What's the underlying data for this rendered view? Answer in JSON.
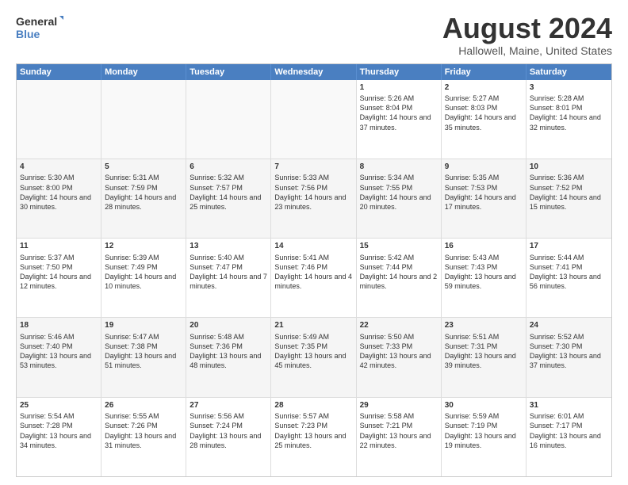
{
  "logo": {
    "line1": "General",
    "line2": "Blue"
  },
  "title": "August 2024",
  "location": "Hallowell, Maine, United States",
  "headers": [
    "Sunday",
    "Monday",
    "Tuesday",
    "Wednesday",
    "Thursday",
    "Friday",
    "Saturday"
  ],
  "rows": [
    [
      {
        "day": "",
        "text": ""
      },
      {
        "day": "",
        "text": ""
      },
      {
        "day": "",
        "text": ""
      },
      {
        "day": "",
        "text": ""
      },
      {
        "day": "1",
        "text": "Sunrise: 5:26 AM\nSunset: 8:04 PM\nDaylight: 14 hours\nand 37 minutes."
      },
      {
        "day": "2",
        "text": "Sunrise: 5:27 AM\nSunset: 8:03 PM\nDaylight: 14 hours\nand 35 minutes."
      },
      {
        "day": "3",
        "text": "Sunrise: 5:28 AM\nSunset: 8:01 PM\nDaylight: 14 hours\nand 32 minutes."
      }
    ],
    [
      {
        "day": "4",
        "text": "Sunrise: 5:30 AM\nSunset: 8:00 PM\nDaylight: 14 hours\nand 30 minutes."
      },
      {
        "day": "5",
        "text": "Sunrise: 5:31 AM\nSunset: 7:59 PM\nDaylight: 14 hours\nand 28 minutes."
      },
      {
        "day": "6",
        "text": "Sunrise: 5:32 AM\nSunset: 7:57 PM\nDaylight: 14 hours\nand 25 minutes."
      },
      {
        "day": "7",
        "text": "Sunrise: 5:33 AM\nSunset: 7:56 PM\nDaylight: 14 hours\nand 23 minutes."
      },
      {
        "day": "8",
        "text": "Sunrise: 5:34 AM\nSunset: 7:55 PM\nDaylight: 14 hours\nand 20 minutes."
      },
      {
        "day": "9",
        "text": "Sunrise: 5:35 AM\nSunset: 7:53 PM\nDaylight: 14 hours\nand 17 minutes."
      },
      {
        "day": "10",
        "text": "Sunrise: 5:36 AM\nSunset: 7:52 PM\nDaylight: 14 hours\nand 15 minutes."
      }
    ],
    [
      {
        "day": "11",
        "text": "Sunrise: 5:37 AM\nSunset: 7:50 PM\nDaylight: 14 hours\nand 12 minutes."
      },
      {
        "day": "12",
        "text": "Sunrise: 5:39 AM\nSunset: 7:49 PM\nDaylight: 14 hours\nand 10 minutes."
      },
      {
        "day": "13",
        "text": "Sunrise: 5:40 AM\nSunset: 7:47 PM\nDaylight: 14 hours\nand 7 minutes."
      },
      {
        "day": "14",
        "text": "Sunrise: 5:41 AM\nSunset: 7:46 PM\nDaylight: 14 hours\nand 4 minutes."
      },
      {
        "day": "15",
        "text": "Sunrise: 5:42 AM\nSunset: 7:44 PM\nDaylight: 14 hours\nand 2 minutes."
      },
      {
        "day": "16",
        "text": "Sunrise: 5:43 AM\nSunset: 7:43 PM\nDaylight: 13 hours\nand 59 minutes."
      },
      {
        "day": "17",
        "text": "Sunrise: 5:44 AM\nSunset: 7:41 PM\nDaylight: 13 hours\nand 56 minutes."
      }
    ],
    [
      {
        "day": "18",
        "text": "Sunrise: 5:46 AM\nSunset: 7:40 PM\nDaylight: 13 hours\nand 53 minutes."
      },
      {
        "day": "19",
        "text": "Sunrise: 5:47 AM\nSunset: 7:38 PM\nDaylight: 13 hours\nand 51 minutes."
      },
      {
        "day": "20",
        "text": "Sunrise: 5:48 AM\nSunset: 7:36 PM\nDaylight: 13 hours\nand 48 minutes."
      },
      {
        "day": "21",
        "text": "Sunrise: 5:49 AM\nSunset: 7:35 PM\nDaylight: 13 hours\nand 45 minutes."
      },
      {
        "day": "22",
        "text": "Sunrise: 5:50 AM\nSunset: 7:33 PM\nDaylight: 13 hours\nand 42 minutes."
      },
      {
        "day": "23",
        "text": "Sunrise: 5:51 AM\nSunset: 7:31 PM\nDaylight: 13 hours\nand 39 minutes."
      },
      {
        "day": "24",
        "text": "Sunrise: 5:52 AM\nSunset: 7:30 PM\nDaylight: 13 hours\nand 37 minutes."
      }
    ],
    [
      {
        "day": "25",
        "text": "Sunrise: 5:54 AM\nSunset: 7:28 PM\nDaylight: 13 hours\nand 34 minutes."
      },
      {
        "day": "26",
        "text": "Sunrise: 5:55 AM\nSunset: 7:26 PM\nDaylight: 13 hours\nand 31 minutes."
      },
      {
        "day": "27",
        "text": "Sunrise: 5:56 AM\nSunset: 7:24 PM\nDaylight: 13 hours\nand 28 minutes."
      },
      {
        "day": "28",
        "text": "Sunrise: 5:57 AM\nSunset: 7:23 PM\nDaylight: 13 hours\nand 25 minutes."
      },
      {
        "day": "29",
        "text": "Sunrise: 5:58 AM\nSunset: 7:21 PM\nDaylight: 13 hours\nand 22 minutes."
      },
      {
        "day": "30",
        "text": "Sunrise: 5:59 AM\nSunset: 7:19 PM\nDaylight: 13 hours\nand 19 minutes."
      },
      {
        "day": "31",
        "text": "Sunrise: 6:01 AM\nSunset: 7:17 PM\nDaylight: 13 hours\nand 16 minutes."
      }
    ]
  ]
}
